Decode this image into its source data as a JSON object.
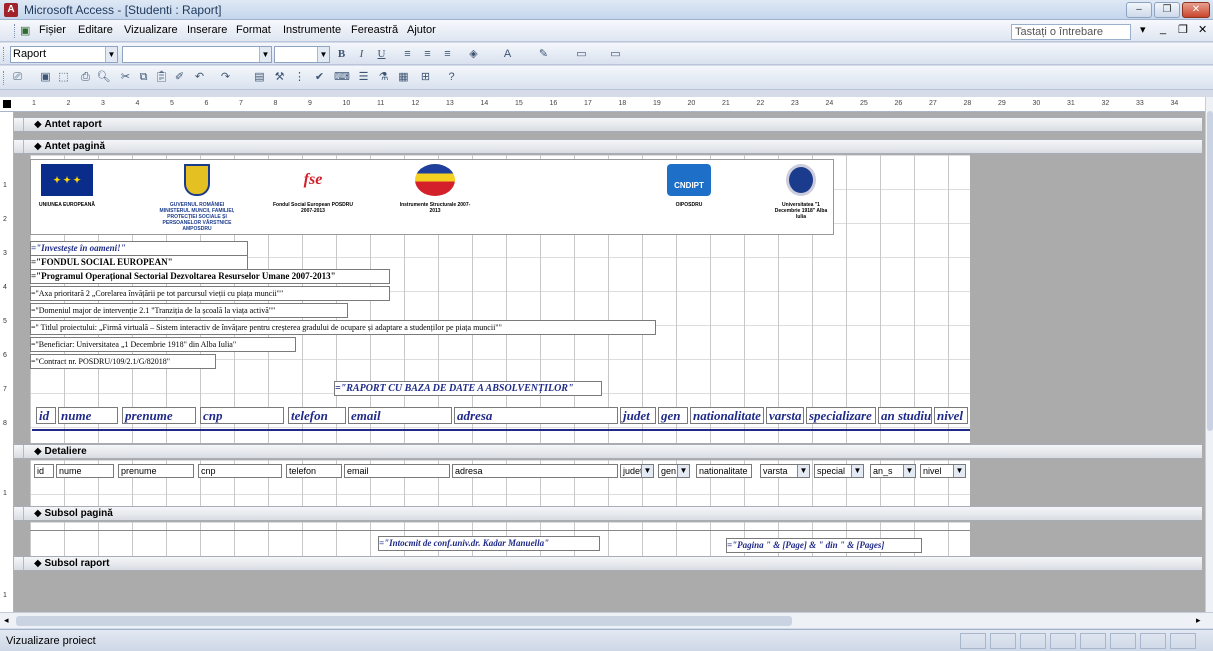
{
  "window": {
    "app_icon": "access-icon",
    "title": "Microsoft Access - [Studenti : Raport]"
  },
  "menu": {
    "items": [
      "Fișier",
      "Editare",
      "Vizualizare",
      "Inserare",
      "Format",
      "Instrumente",
      "Fereastră",
      "Ajutor"
    ],
    "help_placeholder": "Tastați o întrebare"
  },
  "format_toolbar": {
    "object_combo": "Raport"
  },
  "ruler": {
    "labels": [
      "1",
      "2",
      "3",
      "4",
      "5",
      "6",
      "7",
      "8",
      "9",
      "10",
      "11",
      "12",
      "13",
      "14",
      "15",
      "16",
      "17",
      "18",
      "19",
      "20",
      "21",
      "22",
      "23",
      "24",
      "25",
      "26",
      "27",
      "28",
      "29",
      "30",
      "31",
      "32",
      "33",
      "34"
    ]
  },
  "sections": {
    "report_header": "Antet raport",
    "page_header": "Antet pagină",
    "detail": "Detaliere",
    "page_footer": "Subsol pagină",
    "report_footer": "Subsol raport"
  },
  "logos": {
    "eu": "UNIUNEA EUROPEANĂ",
    "gov": "GUVERNUL ROMÂNIEI MINISTERUL MUNCII, FAMILIEI, PROTECȚIEI SOCIALE ȘI PERSOANELOR VÂRSTNICE AMPOSDRU",
    "fse_mark": "fse",
    "fse": "Fondul Social European POSDRU 2007-2013",
    "is": "Instrumente Structurale 2007-2013",
    "cndipt_mark": "CNDIPT",
    "cndipt": "OIPOSDRU",
    "univ": "Universitatea \"1 Decembrie 1918\" Alba Iulia"
  },
  "header_labels": [
    "=\"Investește în oameni!\"",
    "=\"FONDUL SOCIAL EUROPEAN\"",
    "=\"Programul Operațional Sectorial Dezvoltarea Resurselor Umane 2007-2013\"",
    "=\"Axa prioritară 2 „Corelarea învățării pe tot parcursul vieții cu piața muncii\"\"",
    "=\"Domeniul major de intervenție 2.1 \"Tranziția de la școală la viața activă\"\"",
    "=\" Titlul proiectului: „Firmă virtuală – Sistem interactiv de învățare pentru creșterea gradului de ocupare și adaptare a studenților pe piața muncii\"\"",
    "=\"Beneficiar: Universitatea „1 Decembrie 1918\" din Alba Iulia\"",
    "=\"Contract nr. POSDRU/109/2.1/G/82018\""
  ],
  "report_title": "=\"RAPORT CU BAZA DE DATE A ABSOLVENȚILOR\"",
  "columns": [
    "id",
    "nume",
    "prenume",
    "cnp",
    "telefon",
    "email",
    "adresa",
    "judet",
    "gen",
    "nationalitate",
    "varsta",
    "specializare",
    "an studiu",
    "nivel"
  ],
  "detail_fields": [
    "id",
    "nume",
    "prenume",
    "cnp",
    "telefon",
    "email",
    "adresa",
    "judet",
    "gen",
    "nationalitate",
    "varsta",
    "special",
    "an_s",
    "nivel"
  ],
  "footer": {
    "author": "=\"Intocmit de conf.univ.dr. Kadar Manuella\"",
    "page": "=\"Pagina \" & [Page] & \" din \" & [Pages]"
  },
  "status": {
    "text": "Vizualizare proiect"
  }
}
